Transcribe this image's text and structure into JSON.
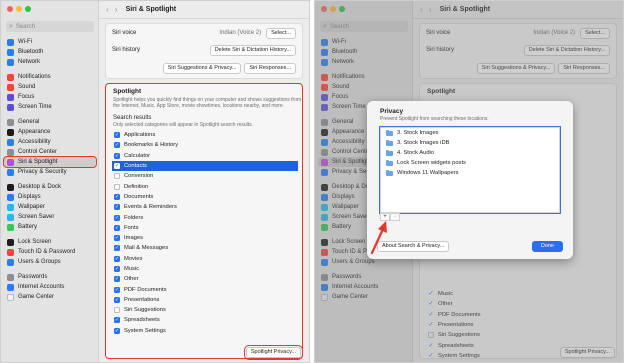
{
  "window_title": "Siri & Spotlight",
  "search_placeholder": "Search",
  "sidebar": {
    "groups": [
      [
        {
          "label": "Wi-Fi",
          "color": "#2a7cf6",
          "icon": "wifi-icon"
        },
        {
          "label": "Bluetooth",
          "color": "#2a7cf6",
          "icon": "bluetooth-icon"
        },
        {
          "label": "Network",
          "color": "#2a7cf6",
          "icon": "network-icon"
        }
      ],
      [
        {
          "label": "Notifications",
          "color": "#f0463b",
          "icon": "notifications-icon"
        },
        {
          "label": "Sound",
          "color": "#f0463b",
          "icon": "sound-icon"
        },
        {
          "label": "Focus",
          "color": "#5b4fd6",
          "icon": "focus-icon"
        },
        {
          "label": "Screen Time",
          "color": "#5b4fd6",
          "icon": "screen-time-icon"
        }
      ],
      [
        {
          "label": "General",
          "color": "#8e8e93",
          "icon": "general-icon"
        },
        {
          "label": "Appearance",
          "color": "#1d1d1f",
          "icon": "appearance-icon"
        },
        {
          "label": "Accessibility",
          "color": "#2a7cf6",
          "icon": "accessibility-icon"
        },
        {
          "label": "Control Center",
          "color": "#8e8e93",
          "icon": "control-center-icon"
        },
        {
          "label": "Siri & Spotlight",
          "color": "#c04bd6",
          "icon": "siri-icon",
          "active": true
        },
        {
          "label": "Privacy & Security",
          "color": "#2a7cf6",
          "icon": "privacy-icon"
        }
      ],
      [
        {
          "label": "Desktop & Dock",
          "color": "#1d1d1f",
          "icon": "desktop-dock-icon"
        },
        {
          "label": "Displays",
          "color": "#2a7cf6",
          "icon": "displays-icon"
        },
        {
          "label": "Wallpaper",
          "color": "#2fb4e8",
          "icon": "wallpaper-icon"
        },
        {
          "label": "Screen Saver",
          "color": "#2fb4e8",
          "icon": "screen-saver-icon"
        },
        {
          "label": "Battery",
          "color": "#34c759",
          "icon": "battery-icon"
        }
      ],
      [
        {
          "label": "Lock Screen",
          "color": "#1d1d1f",
          "icon": "lock-screen-icon"
        },
        {
          "label": "Touch ID & Password",
          "color": "#f0463b",
          "icon": "touch-id-icon"
        },
        {
          "label": "Users & Groups",
          "color": "#2a7cf6",
          "icon": "users-groups-icon"
        }
      ],
      [
        {
          "label": "Passwords",
          "color": "#8e8e93",
          "icon": "passwords-icon"
        },
        {
          "label": "Internet Accounts",
          "color": "#2a7cf6",
          "icon": "internet-accounts-icon"
        },
        {
          "label": "Game Center",
          "color": "#f2f2f2",
          "icon": "game-center-icon"
        }
      ]
    ]
  },
  "siri": {
    "voice_label": "Siri voice",
    "voice_value": "Indian (Voice 2)",
    "select_button": "Select...",
    "history_label": "Siri history",
    "delete_history_button": "Delete Siri & Dictation History...",
    "suggestions_button": "Siri Suggestions & Privacy...",
    "responses_button": "Siri Responses..."
  },
  "spotlight": {
    "title": "Spotlight",
    "description": "Spotlight helps you quickly find things on your computer and shows suggestions from the Internet, Music, App Store, movie showtimes, locations nearby, and more.",
    "results_heading": "Search results",
    "results_sub": "Only selected categories will appear in Spotlight search results.",
    "categories": [
      {
        "label": "Applications",
        "checked": true
      },
      {
        "label": "Bookmarks & History",
        "checked": true
      },
      {
        "label": "Calculator",
        "checked": true
      },
      {
        "label": "Contacts",
        "checked": true,
        "selected": true
      },
      {
        "label": "Conversion",
        "checked": false
      },
      {
        "label": "Definition",
        "checked": false
      },
      {
        "label": "Documents",
        "checked": true
      },
      {
        "label": "Events & Reminders",
        "checked": true
      },
      {
        "label": "Folders",
        "checked": true
      },
      {
        "label": "Fonts",
        "checked": true
      },
      {
        "label": "Images",
        "checked": true
      },
      {
        "label": "Mail & Messages",
        "checked": true
      },
      {
        "label": "Movies",
        "checked": true
      },
      {
        "label": "Music",
        "checked": true
      },
      {
        "label": "Other",
        "checked": true
      },
      {
        "label": "PDF Documents",
        "checked": true
      },
      {
        "label": "Presentations",
        "checked": true
      },
      {
        "label": "Siri Suggestions",
        "checked": false
      },
      {
        "label": "Spreadsheets",
        "checked": true
      },
      {
        "label": "System Settings",
        "checked": true
      }
    ],
    "privacy_button": "Spotlight Privacy..."
  },
  "right_partial_list": [
    {
      "label": "Music",
      "checked": true
    },
    {
      "label": "Other",
      "checked": true
    },
    {
      "label": "PDF Documents",
      "checked": true
    },
    {
      "label": "Presentations",
      "checked": true
    },
    {
      "label": "Siri Suggestions",
      "checked": false
    },
    {
      "label": "Spreadsheets",
      "checked": true
    },
    {
      "label": "System Settings",
      "checked": true
    }
  ],
  "privacy_dialog": {
    "title": "Privacy",
    "subtitle": "Prevent Spotlight from searching these locations.",
    "folders": [
      "3. Stock Images",
      "3. Stock Images iDB",
      "4. Stock Audio",
      "Lock Screen widgets posts",
      "Windows 11 Wallpapers"
    ],
    "add_symbol": "+",
    "remove_symbol": "−",
    "about_button": "About Search & Privacy...",
    "done_button": "Done"
  },
  "colors": {
    "highlight": "#e3382b",
    "accent": "#2a6ff0"
  }
}
